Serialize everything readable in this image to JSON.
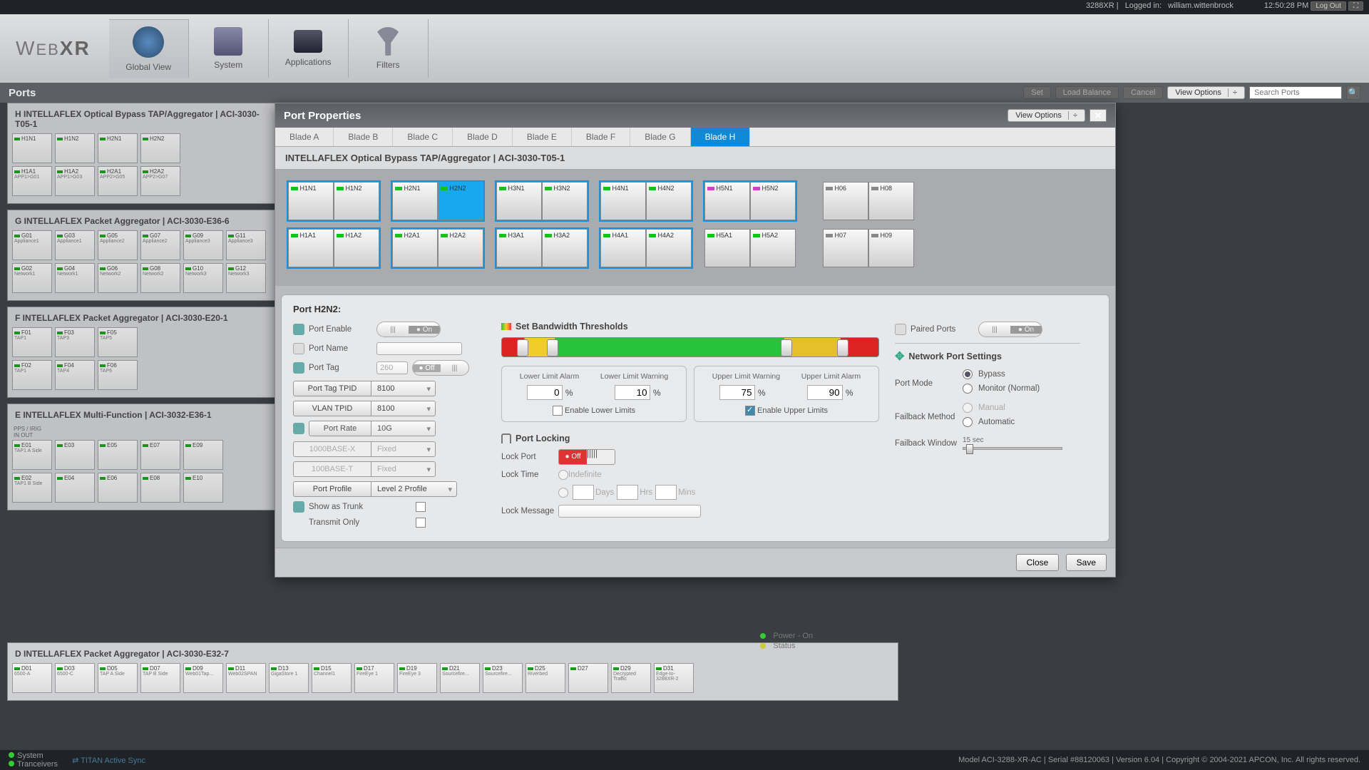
{
  "topbar": {
    "device": "3288XR",
    "loginLabel": "Logged in:",
    "user": "william.wittenbrock",
    "time": "12:50:28 PM",
    "logout": "Log Out"
  },
  "brand": {
    "a": "W",
    "b": "EB",
    "c": "XR"
  },
  "nav": [
    "Global View",
    "System",
    "Applications",
    "Filters"
  ],
  "toolbar": {
    "title": "Ports",
    "set": "Set",
    "lb": "Load Balance",
    "cancel": "Cancel",
    "vopts": "View Options",
    "searchPh": "Search Ports"
  },
  "modal": {
    "title": "Port Properties",
    "vopts": "View Options",
    "tabs": [
      "Blade A",
      "Blade B",
      "Blade C",
      "Blade D",
      "Blade E",
      "Blade F",
      "Blade G",
      "Blade H"
    ],
    "activeTab": 7,
    "bladeTitle": "INTELLAFLEX Optical Bypass TAP/Aggregator | ACI-3030-T05-1",
    "rowN": [
      [
        "H1N1",
        "H1N2"
      ],
      [
        "H2N1",
        "H2N2"
      ],
      [
        "H3N1",
        "H3N2"
      ],
      [
        "H4N1",
        "H4N2"
      ],
      [
        "H5N1",
        "H5N2"
      ],
      [
        "H06",
        "H08"
      ]
    ],
    "rowA": [
      [
        "H1A1",
        "H1A2"
      ],
      [
        "H2A1",
        "H2A2"
      ],
      [
        "H3A1",
        "H3A2"
      ],
      [
        "H4A1",
        "H4A2"
      ],
      [
        "H5A1",
        "H5A2"
      ],
      [
        "H07",
        "H09"
      ]
    ],
    "portName": "Port H2N2:",
    "labels": {
      "portEnable": "Port Enable",
      "on": "On",
      "off": "Off",
      "portNameL": "Port Name",
      "portTag": "Port Tag",
      "tagVal": "260",
      "portTagTpid": "Port Tag TPID",
      "vlanTpid": "VLAN TPID",
      "t8100": "8100",
      "portRate": "Port Rate",
      "r10g": "10G",
      "r1000": "1000BASE-X",
      "r100": "100BASE-T",
      "fixed": "Fixed",
      "portProfile": "Port Profile",
      "profVal": "Level 2 Profile",
      "showTrunk": "Show as Trunk",
      "txOnly": "Transmit Only",
      "bwTitle": "Set Bandwidth Thresholds",
      "lla": "Lower Limit Alarm",
      "llw": "Lower Limit Warning",
      "ulw": "Upper Limit Warning",
      "ula": "Upper Limit Alarm",
      "v0": "0",
      "v10": "10",
      "v75": "75",
      "v90": "90",
      "pct": "%",
      "enLower": "Enable Lower Limits",
      "enUpper": "Enable Upper Limits",
      "portLock": "Port Locking",
      "lockPort": "Lock Port",
      "lockTime": "Lock Time",
      "indef": "Indefinite",
      "days": "Days",
      "hrs": "Hrs",
      "mins": "Mins",
      "lockMsg": "Lock Message",
      "paired": "Paired Ports",
      "nps": "Network Port Settings",
      "portMode": "Port Mode",
      "bypass": "Bypass",
      "monitor": "Monitor (Normal)",
      "fbMethod": "Failback Method",
      "manual": "Manual",
      "auto": "Automatic",
      "fbWindow": "Failback Window",
      "fbVal": "15 sec"
    },
    "close": "Close",
    "save": "Save"
  },
  "bgBlades": {
    "H": {
      "t": "H  INTELLAFLEX Optical Bypass TAP/Aggregator | ACI-3030-T05-1",
      "r1": [
        [
          "H1N1",
          ""
        ],
        [
          "H1N2",
          ""
        ],
        [
          "H2N1",
          ""
        ],
        [
          "H2N2",
          ""
        ]
      ],
      "r2": [
        [
          "H1A1",
          "APP1>G01"
        ],
        [
          "H1A2",
          "APP1>G03"
        ],
        [
          "H2A1",
          "APP2>G05"
        ],
        [
          "H2A2",
          "APP2>G07"
        ]
      ]
    },
    "G": {
      "t": "G  INTELLAFLEX Packet Aggregator | ACI-3030-E36-6",
      "r1": [
        [
          "G01",
          "Appliance1"
        ],
        [
          "G03",
          "Appliance1"
        ],
        [
          "G05",
          "Appliance2"
        ],
        [
          "G07",
          "Appliance2"
        ],
        [
          "G09",
          "Appliance3"
        ],
        [
          "G11",
          "Appliance3"
        ]
      ],
      "r2": [
        [
          "G02",
          "Network1"
        ],
        [
          "G04",
          "Network1"
        ],
        [
          "G06",
          "Network2"
        ],
        [
          "G08",
          "Network2"
        ],
        [
          "G10",
          "Network3"
        ],
        [
          "G12",
          "Network3"
        ]
      ]
    },
    "F": {
      "t": "F  INTELLAFLEX Packet Aggregator | ACI-3030-E20-1",
      "r1": [
        [
          "F01",
          "TAP1"
        ],
        [
          "F03",
          "TAP3"
        ],
        [
          "F05",
          "TAP5"
        ]
      ],
      "r2": [
        [
          "F02",
          "TAP1"
        ],
        [
          "F04",
          "TAP4"
        ],
        [
          "F06",
          "TAP6"
        ]
      ]
    },
    "E": {
      "t": "E  INTELLAFLEX Multi-Function | ACI-3032-E36-1",
      "r0": [
        "PPS / IRIG",
        "IN   OUT"
      ],
      "r1": [
        [
          "E01",
          "TAP1 A Side"
        ],
        [
          "E03",
          ""
        ],
        [
          "E05",
          ""
        ],
        [
          "E07",
          ""
        ],
        [
          "E09",
          ""
        ]
      ],
      "r2": [
        [
          "E02",
          "TAP1 B Side"
        ],
        [
          "E04",
          ""
        ],
        [
          "E06",
          ""
        ],
        [
          "E08",
          ""
        ],
        [
          "E10",
          ""
        ]
      ]
    }
  },
  "sectionD": {
    "t": "D  INTELLAFLEX Packet Aggregator | ACI-3030-E32-7",
    "r": [
      [
        "D01",
        "6500-A"
      ],
      [
        "D03",
        "6500-C"
      ],
      [
        "D05",
        "TAP A Side"
      ],
      [
        "D07",
        "TAP B Side"
      ],
      [
        "D09",
        "Web01Tap..."
      ],
      [
        "D11",
        "Web02SPAN"
      ],
      [
        "D13",
        "GigaStore 1"
      ],
      [
        "D15",
        "Channel1"
      ],
      [
        "D17",
        "FireEye 1"
      ],
      [
        "D19",
        "FireEye 3"
      ],
      [
        "D21",
        "Sourcefire..."
      ],
      [
        "D23",
        "Sourcefire..."
      ],
      [
        "D25",
        "Riverbed"
      ],
      [
        "D27",
        ""
      ],
      [
        "D29",
        "Decrypted Traffic"
      ],
      [
        "D31",
        "Edge-to-3288XR-2"
      ]
    ]
  },
  "power": {
    "a": "Power - On",
    "b": "Status"
  },
  "status": {
    "sys": "System",
    "trc": "Tranceivers",
    "titan": "TITAN Active Sync",
    "right": "Model ACI-3288-XR-AC | Serial #88120063 | Version 6.04 | Copyright © 2004-2021 APCON, Inc. All rights reserved."
  }
}
